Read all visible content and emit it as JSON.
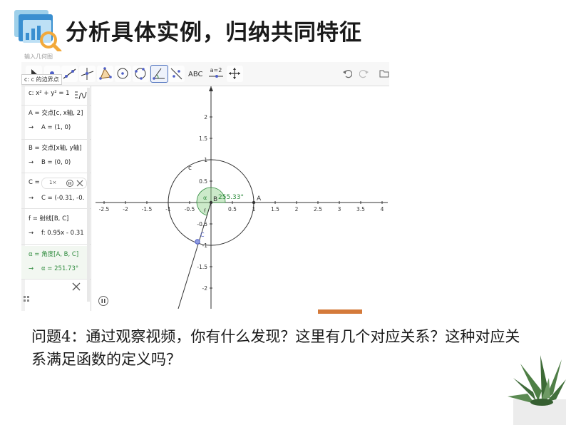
{
  "slide": {
    "title": "分析具体实例，归纳共同特征",
    "question": "问题4：通过观察视频，你有什么发现？这里有几个对应关系？这种对应关系满足函数的定义吗？"
  },
  "app": {
    "hint": "输入几何图",
    "tooltip": "c: c 的边界点",
    "toolbar": {
      "text_tool_label": "ABC",
      "slider_tool_label": "a=2"
    },
    "algebra": {
      "rows": [
        {
          "def": "c: x² + y² = 1",
          "res": ""
        },
        {
          "def": "A = 交点[c, x轴, 2]",
          "res": "A = (1, 0)"
        },
        {
          "def": "B = 交点[x轴, y轴]",
          "res": "B = (0, 0)"
        },
        {
          "def": "C = ",
          "res": "C = (-0.31, -0."
        },
        {
          "def": "f = 射线[B, C]",
          "res": "f: 0.95x - 0.31"
        },
        {
          "def": "α = 角度[A, B, C]",
          "res": "α = 251.73°"
        }
      ],
      "arrow": "→",
      "speed": "1×"
    },
    "graph": {
      "x_ticks": [
        "-2.5",
        "-2",
        "-1.5",
        "-1",
        "-0.5",
        "0.5",
        "1",
        "1.5",
        "2",
        "2.5",
        "3",
        "3.5",
        "4"
      ],
      "y_ticks": [
        "2",
        "1.5",
        "1",
        "0.5",
        "-0.5",
        "-1",
        "-1.5",
        "-2"
      ],
      "labels": {
        "circle": "c",
        "A": "A",
        "B": "B",
        "C": "C",
        "f": "f",
        "alpha": "α",
        "angle": "255.33°"
      },
      "angle_color": "#2e8b3d",
      "point_color": "#4f5fc7"
    }
  }
}
